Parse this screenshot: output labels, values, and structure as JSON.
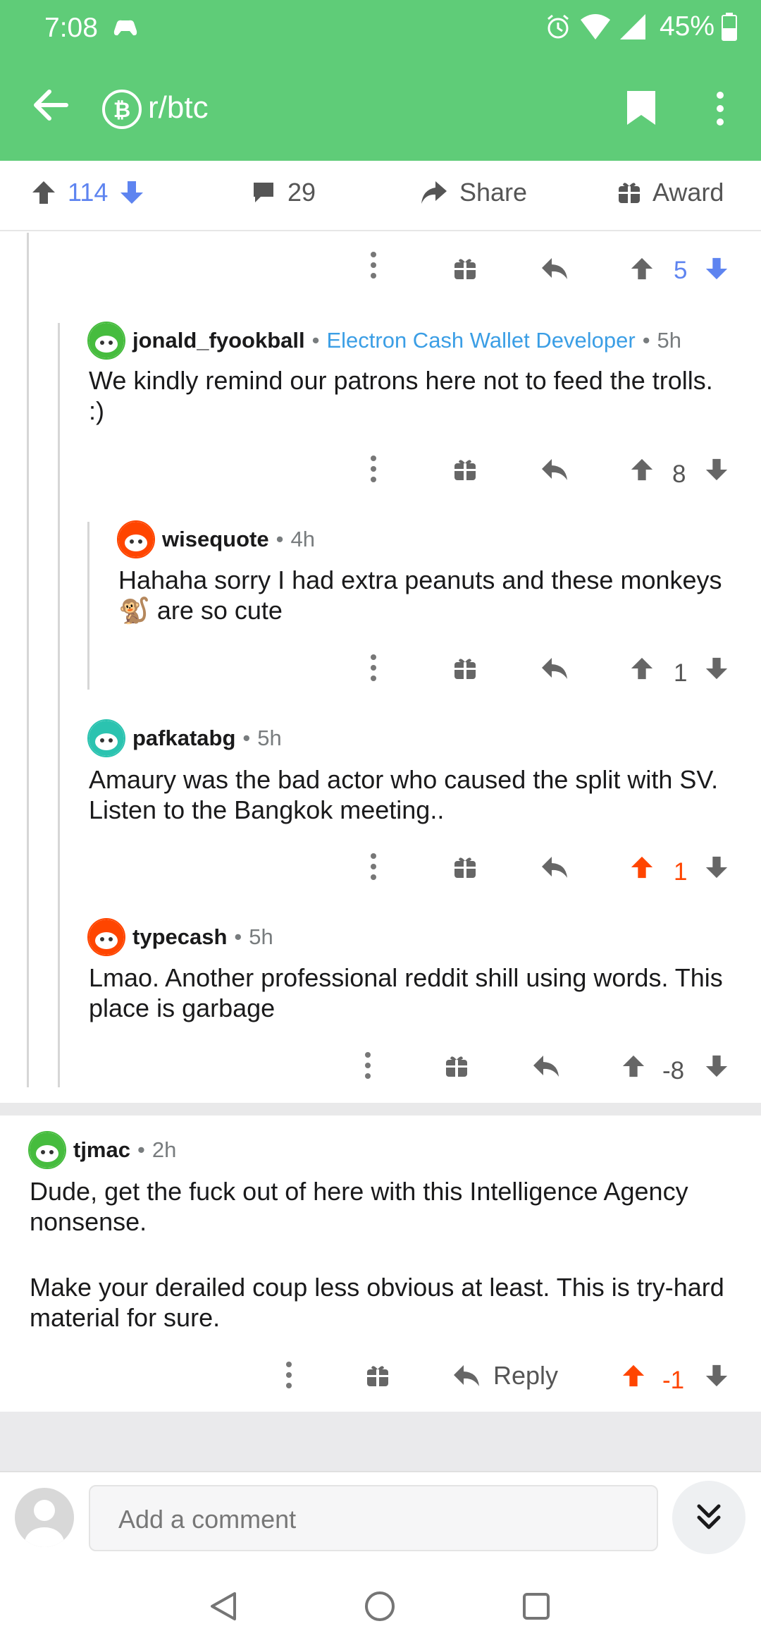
{
  "status_bar": {
    "time": "7:08",
    "battery": "45%"
  },
  "app_bar": {
    "subreddit": "r/btc"
  },
  "post_bar": {
    "votes": "114",
    "comments": "29",
    "share": "Share",
    "award": "Award"
  },
  "comments": [
    {
      "id": "c0",
      "score": "5",
      "vote_state": "none"
    },
    {
      "id": "c1",
      "username": "jonald_fyookball",
      "flair": "Electron Cash Wallet Developer",
      "age": "5h",
      "body": "We kindly remind our patrons here not to feed the trolls. :)",
      "score": "8"
    },
    {
      "id": "c2",
      "username": "wisequote",
      "age": "4h",
      "body_pre": "Hahaha sorry I had extra peanuts and these monkeys",
      "emoji": "🐒",
      "body_post": "are so cute",
      "score": "1"
    },
    {
      "id": "c3",
      "username": "pafkatabg",
      "age": "5h",
      "body": "Amaury was the bad actor who caused the split with SV. Listen to the Bangkok meeting..",
      "score": "1",
      "vote_state": "upvoted"
    },
    {
      "id": "c4",
      "username": "typecash",
      "age": "5h",
      "body": "Lmao. Another professional reddit shill using words. This place is garbage",
      "score": "-8"
    },
    {
      "id": "c5",
      "username": "tjmac",
      "age": "2h",
      "body_p1": "Dude, get the fuck out of here with this Intelligence Agency nonsense.",
      "body_p2": "Make your derailed coup less obvious at least. This is try-hard material for sure.",
      "reply_label": "Reply",
      "score": "-1",
      "vote_state": "upvoted"
    }
  ],
  "composer": {
    "placeholder": "Add a comment"
  },
  "colors": {
    "header_green": "#5fcc78",
    "upvote_orange": "#ff4500",
    "vote_blue": "#5e84f0",
    "flair_blue": "#3b9ee5"
  }
}
